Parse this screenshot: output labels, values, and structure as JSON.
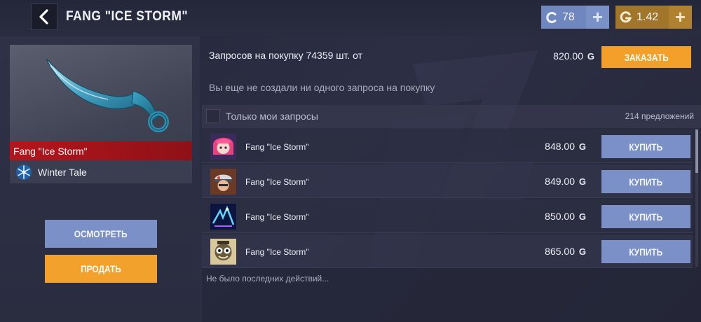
{
  "header": {
    "back_icon": "chevron-left-icon",
    "title": "FANG \"ICE STORM\"",
    "silver": {
      "icon": "silver-coin-icon",
      "value": "78",
      "plus_label": "+"
    },
    "gold": {
      "icon": "gold-coin-icon",
      "value": "1.42",
      "plus_label": "+"
    }
  },
  "item": {
    "image_icon": "karambit-knife-icon",
    "name": "Fang \"Ice Storm\"",
    "collection_icon": "snowflake-icon",
    "collection": "Winter Tale"
  },
  "actions": {
    "inspect_label": "ОСМОТРЕТЬ",
    "sell_label": "ПРОДАТЬ"
  },
  "buy_request": {
    "text": "Запросов на покупку 74359 шт. от",
    "price": "820.00",
    "currency_symbol": "G",
    "order_label": "ЗАКАЗАТЬ",
    "empty_message": "Вы еще не создали ни одного запроса на покупку"
  },
  "filter": {
    "label": "Только мои запросы",
    "checked": false,
    "offers_count": "214 предложений"
  },
  "offers": [
    {
      "avatar_icon": "pink-hair-avatar-icon",
      "name": "Fang \"Ice Storm\"",
      "price": "848.00",
      "buy_label": "КУПИТЬ"
    },
    {
      "avatar_icon": "helmet-soldier-avatar-icon",
      "name": "Fang \"Ice Storm\"",
      "price": "849.00",
      "buy_label": "КУПИТЬ"
    },
    {
      "avatar_icon": "neon-figure-avatar-icon",
      "name": "Fang \"Ice Storm\"",
      "price": "850.00",
      "buy_label": "КУПИТЬ"
    },
    {
      "avatar_icon": "cartoon-mask-avatar-icon",
      "name": "Fang \"Ice Storm\"",
      "price": "865.00",
      "buy_label": "КУПИТЬ"
    }
  ],
  "history": {
    "text": "Не было последних действий..."
  },
  "colors": {
    "accent_orange": "#f2a02a",
    "accent_blue": "#7b90c6",
    "rarity_red": "#b3161c",
    "silver_currency": "#6f86bf",
    "gold_currency": "#a2762a"
  }
}
